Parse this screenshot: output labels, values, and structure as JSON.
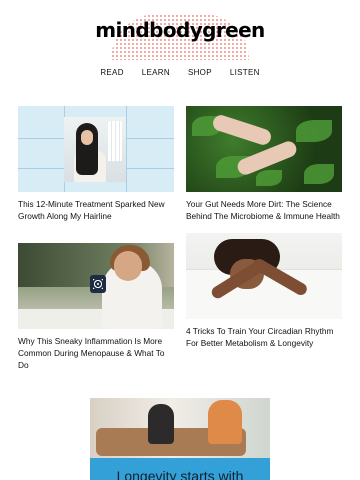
{
  "header": {
    "logo": "mindbodygreen",
    "nav": [
      "READ",
      "LEARN",
      "SHOP",
      "LISTEN"
    ]
  },
  "articles": [
    {
      "title": "This 12-Minute Treatment Sparked New Growth Along My Hairline"
    },
    {
      "title": "Your Gut Needs More Dirt: The Science Behind The Microbiome & Immune Health"
    },
    {
      "title": "Why This Sneaky Inflammation Is More Common During Menopause & What To Do"
    },
    {
      "title": "4 Tricks To Train Your Circadian Rhythm For Better Metabolism & Longevity"
    }
  ],
  "promo": {
    "text": "Longevity starts with"
  },
  "colors": {
    "logo_accent": "#f08a86",
    "card1_bg": "#d8ecf6",
    "promo_band": "#34a0d8"
  }
}
